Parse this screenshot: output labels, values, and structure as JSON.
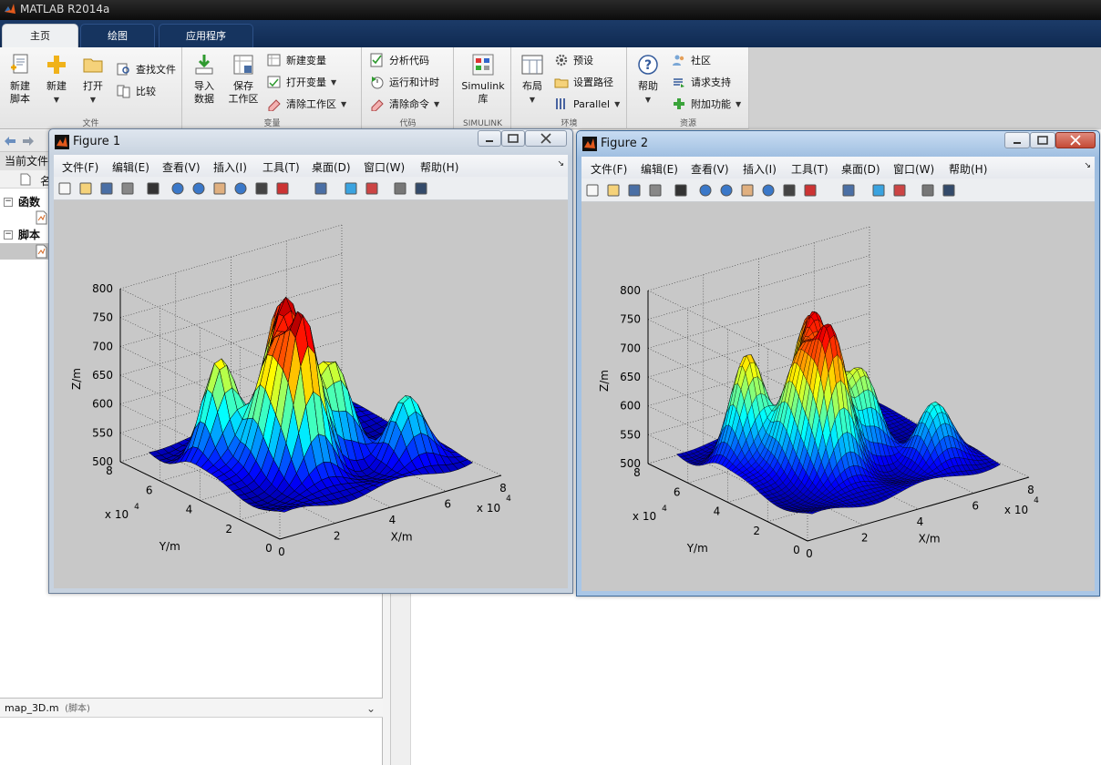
{
  "window": {
    "title": "MATLAB R2014a"
  },
  "tabs": [
    {
      "label": "主页"
    },
    {
      "label": "绘图"
    },
    {
      "label": "应用程序"
    }
  ],
  "ribbon": {
    "file_group": {
      "label": "文件",
      "new_script": "新建\n脚本",
      "new": "新建",
      "open": "打开",
      "find_files": "查找文件",
      "compare": "比较"
    },
    "variable_group": {
      "label": "变量",
      "import_data": "导入\n数据",
      "save_workspace": "保存\n工作区",
      "new_variable": "新建变量",
      "open_variable": "打开变量",
      "clear_workspace": "清除工作区"
    },
    "code_group": {
      "label": "代码",
      "analyze_code": "分析代码",
      "run_and_time": "运行和计时",
      "clear_commands": "清除命令"
    },
    "simulink_group": {
      "label": "SIMULINK",
      "simulink_library": "Simulink\n库"
    },
    "environment_group": {
      "label": "环境",
      "layout": "布局",
      "preferences": "预设",
      "set_path": "设置路径",
      "parallel": "Parallel"
    },
    "resources_group": {
      "label": "资源",
      "help": "帮助",
      "community": "社区",
      "request_support": "请求支持",
      "add_ons": "附加功能"
    }
  },
  "left_panel": {
    "current_folder_label": "当前文件",
    "col_name": "名",
    "tree": [
      {
        "label": "函数"
      },
      {
        "label": "脚本"
      }
    ],
    "details": {
      "file": "map_3D.m",
      "type": "(脚本)"
    }
  },
  "figures": [
    {
      "title": "Figure 1",
      "menu": [
        "文件(F)",
        "编辑(E)",
        "查看(V)",
        "插入(I)",
        "工具(T)",
        "桌面(D)",
        "窗口(W)",
        "帮助(H)"
      ]
    },
    {
      "title": "Figure 2",
      "menu": [
        "文件(F)",
        "编辑(E)",
        "查看(V)",
        "插入(I)",
        "工具(T)",
        "桌面(D)",
        "窗口(W)",
        "帮助(H)"
      ]
    }
  ],
  "chart_data": [
    {
      "type": "surface",
      "zlabel": "Z/m",
      "xlabel": "X/m",
      "ylabel": "Y/m",
      "z_ticks": [
        "500",
        "550",
        "600",
        "650",
        "700",
        "750",
        "800"
      ],
      "x_ticks": [
        "0",
        "2",
        "4",
        "6",
        "8"
      ],
      "y_ticks": [
        "0",
        "2",
        "4",
        "6",
        "8"
      ],
      "x_scale": "x 10",
      "y_scale": "x 10",
      "exponent": "4",
      "zlim": [
        500,
        800
      ],
      "xlim": [
        0,
        80000
      ],
      "ylim": [
        0,
        80000
      ],
      "grid": "on",
      "colormap": "jet",
      "peaks": [
        {
          "x": 30000,
          "y": 30000,
          "z": 780
        },
        {
          "x": 35000,
          "y": 45000,
          "z": 760
        },
        {
          "x": 40000,
          "y": 55000,
          "z": 740
        },
        {
          "x": 18000,
          "y": 55000,
          "z": 700
        },
        {
          "x": 25000,
          "y": 40000,
          "z": 690
        },
        {
          "x": 45000,
          "y": 35000,
          "z": 680
        },
        {
          "x": 60000,
          "y": 20000,
          "z": 630
        }
      ]
    },
    {
      "type": "surface",
      "zlabel": "Z/m",
      "xlabel": "X/m",
      "ylabel": "Y/m",
      "z_ticks": [
        "500",
        "550",
        "600",
        "650",
        "700",
        "750",
        "800"
      ],
      "x_ticks": [
        "0",
        "2",
        "4",
        "6",
        "8"
      ],
      "y_ticks": [
        "0",
        "2",
        "4",
        "6",
        "8"
      ],
      "x_scale": "x 10",
      "y_scale": "x 10",
      "exponent": "4",
      "zlim": [
        500,
        800
      ],
      "xlim": [
        0,
        80000
      ],
      "ylim": [
        0,
        80000
      ],
      "grid": "on",
      "colormap": "jet",
      "peaks": [
        {
          "x": 30000,
          "y": 30000,
          "z": 760
        },
        {
          "x": 35000,
          "y": 45000,
          "z": 740
        },
        {
          "x": 40000,
          "y": 55000,
          "z": 720
        },
        {
          "x": 18000,
          "y": 55000,
          "z": 710
        },
        {
          "x": 25000,
          "y": 40000,
          "z": 690
        },
        {
          "x": 45000,
          "y": 35000,
          "z": 670
        },
        {
          "x": 60000,
          "y": 20000,
          "z": 620
        }
      ]
    }
  ]
}
